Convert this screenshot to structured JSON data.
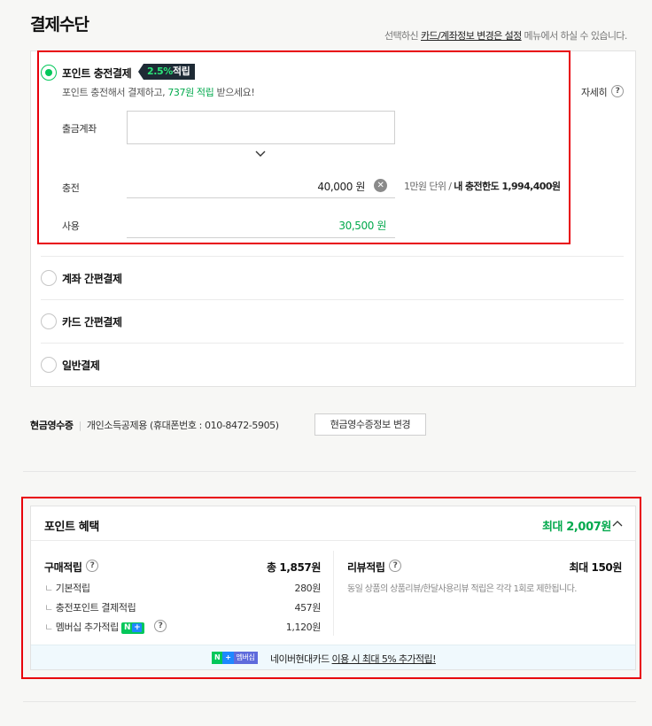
{
  "header": {
    "title": "결제수단",
    "notice_prefix": "선택하신 ",
    "notice_link": "카드/계좌정보 변경은 설정",
    "notice_suffix": " 메뉴에서 하실 수 있습니다."
  },
  "payment": {
    "point_charge": {
      "label": "포인트 충전결제",
      "badge_pct": "2.5%",
      "badge_suffix": "적립",
      "sub_prefix": "포인트 충전해서 결제하고, ",
      "sub_highlight": "737원 적립",
      "sub_suffix": " 받으세요!",
      "detail_label": "자세히",
      "account_label": "출금계좌",
      "charge_label": "충전",
      "charge_value": "40,000 원",
      "limit_unit": "1만원 단위 / ",
      "limit_text": "내 충전한도 1,994,400원",
      "use_label": "사용",
      "use_value": "30,500 원",
      "selected": true
    },
    "options": [
      {
        "label": "계좌 간편결제",
        "selected": false
      },
      {
        "label": "카드 간편결제",
        "selected": false
      },
      {
        "label": "일반결제",
        "selected": false
      }
    ]
  },
  "receipt": {
    "label": "현금영수증",
    "info": "개인소득공제용 (휴대폰번호 : 010-8472-5905)",
    "change_button": "현금영수증정보 변경"
  },
  "benefits": {
    "title": "포인트 혜택",
    "max_label": "최대 2,007원",
    "purchase": {
      "label": "구매적립",
      "total": "총 1,857원",
      "rows": [
        {
          "label": "기본적립",
          "value": "280원"
        },
        {
          "label": "충전포인트 결제적립",
          "value": "457원"
        },
        {
          "label": "멤버십 추가적립",
          "value": "1,120원"
        }
      ]
    },
    "review": {
      "label": "리뷰적립",
      "total": "최대 150원",
      "note": "동일 상품의 상품리뷰/한달사용리뷰 적립은 각각 1회로 제한됩니다."
    },
    "promo": {
      "badge_n": "N",
      "badge_plus": "+",
      "badge_member": "멤버십",
      "text_prefix": "네이버현대카드 ",
      "text_link": "이용 시 최대 5% 추가적립!"
    }
  },
  "colors": {
    "accent_green": "#03c75a",
    "highlight_red": "#e8000b",
    "badge_dark": "#1e2a35"
  }
}
